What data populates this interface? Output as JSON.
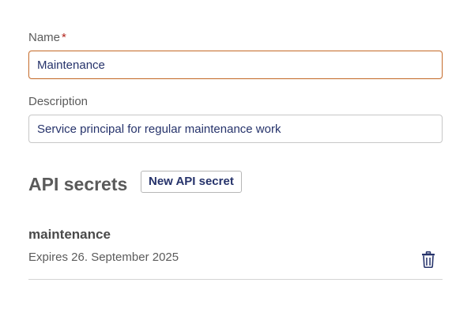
{
  "form": {
    "name": {
      "label": "Name",
      "required_mark": "*",
      "value": "Maintenance"
    },
    "description": {
      "label": "Description",
      "value": "Service principal for regular maintenance work"
    }
  },
  "api_secrets": {
    "title": "API secrets",
    "new_button_label": "New API secret",
    "items": [
      {
        "name": "maintenance",
        "expires": "Expires 26. September 2025",
        "delete_icon": "trash-icon"
      }
    ]
  },
  "colors": {
    "accent_text": "#26336b",
    "focus_border": "#c9763a",
    "required": "#b3261e"
  }
}
